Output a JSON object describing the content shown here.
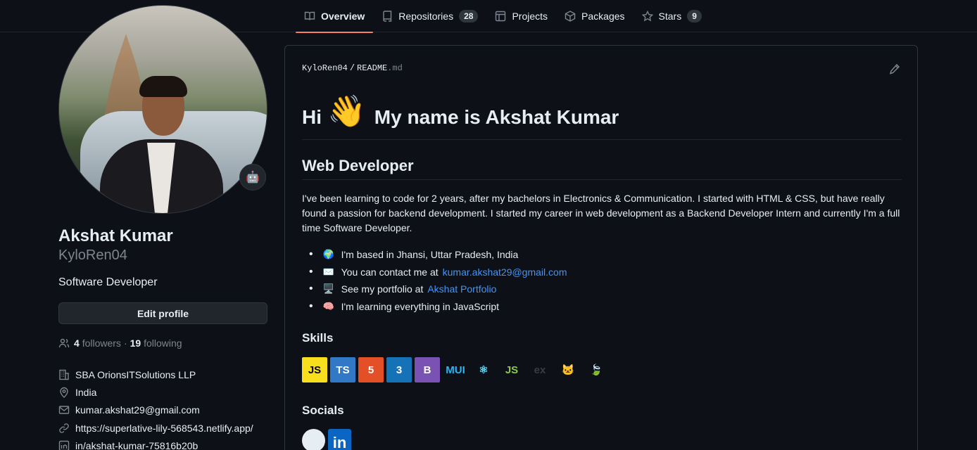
{
  "nav": {
    "tabs": [
      {
        "label": "Overview",
        "icon": "book-icon",
        "active": true
      },
      {
        "label": "Repositories",
        "icon": "repo-icon",
        "count": "28"
      },
      {
        "label": "Projects",
        "icon": "table-icon"
      },
      {
        "label": "Packages",
        "icon": "package-icon"
      },
      {
        "label": "Stars",
        "icon": "star-icon",
        "count": "9"
      }
    ]
  },
  "profile": {
    "status_emoji": "🤖",
    "fullname": "Akshat Kumar",
    "username": "KyloRen04",
    "bio": "Software Developer",
    "edit_label": "Edit profile",
    "followers_count": "4",
    "followers_label": "followers",
    "separator": "·",
    "following_count": "19",
    "following_label": "following",
    "details": [
      {
        "icon": "organization-icon",
        "text": "SBA OrionsITSolutions LLP"
      },
      {
        "icon": "location-icon",
        "text": "India"
      },
      {
        "icon": "mail-icon",
        "text": "kumar.akshat29@gmail.com"
      },
      {
        "icon": "link-icon",
        "text": "https://superlative-lily-568543.netlify.app/"
      },
      {
        "icon": "linkedin-icon",
        "text": "in/akshat-kumar-75816b20b"
      }
    ]
  },
  "readme": {
    "crumb_user": "KyloRen04",
    "crumb_sep": "/",
    "crumb_file": "README",
    "crumb_ext": ".md",
    "h1_prefix": "Hi",
    "h1_emoji": "👋",
    "h1_suffix": "My name is Akshat Kumar",
    "h2": "Web Developer",
    "paragraph": "I've been learning to code for 2 years, after my bachelors in Electronics & Communication. I started with HTML & CSS, but have really found a passion for backend development. I started my career in web development as a Backend Developer Intern and currently I'm a full time Software Developer.",
    "list": [
      {
        "emoji": "🌍",
        "text": "I'm based in Jhansi, Uttar Pradesh, India",
        "link": ""
      },
      {
        "emoji": "✉️",
        "text": "You can contact me at",
        "link": "kumar.akshat29@gmail.com"
      },
      {
        "emoji": "🖥️",
        "text": "See my portfolio at",
        "link": "Akshat Portfolio"
      },
      {
        "emoji": "🧠",
        "text": "I'm learning everything in JavaScript",
        "link": ""
      }
    ],
    "skills_title": "Skills",
    "skills": [
      {
        "name": "javascript-icon",
        "label": "JS",
        "bg": "#f7df1e",
        "fg": "#000000"
      },
      {
        "name": "typescript-icon",
        "label": "TS",
        "bg": "#3178c6",
        "fg": "#ffffff"
      },
      {
        "name": "html5-icon",
        "label": "5",
        "bg": "#e34f26",
        "fg": "#ffffff"
      },
      {
        "name": "css3-icon",
        "label": "3",
        "bg": "#1572b6",
        "fg": "#ffffff"
      },
      {
        "name": "bootstrap-icon",
        "label": "B",
        "bg": "#7952b3",
        "fg": "#ffffff"
      },
      {
        "name": "mui-icon",
        "label": "MUI",
        "bg": "transparent",
        "fg": "#29b6f6"
      },
      {
        "name": "react-icon",
        "label": "⚛",
        "bg": "transparent",
        "fg": "#61dafb"
      },
      {
        "name": "nodejs-icon",
        "label": "JS",
        "bg": "transparent",
        "fg": "#8cc84b"
      },
      {
        "name": "express-icon",
        "label": "ex",
        "bg": "transparent",
        "fg": "#3c3c3c"
      },
      {
        "name": "nestjs-icon",
        "label": "🐱",
        "bg": "transparent",
        "fg": "#e0234e"
      },
      {
        "name": "mongodb-icon",
        "label": "🍃",
        "bg": "transparent",
        "fg": "#47a248"
      }
    ],
    "socials_title": "Socials",
    "socials": [
      {
        "name": "github-icon",
        "label": ""
      },
      {
        "name": "linkedin-icon",
        "label": "in"
      }
    ]
  }
}
